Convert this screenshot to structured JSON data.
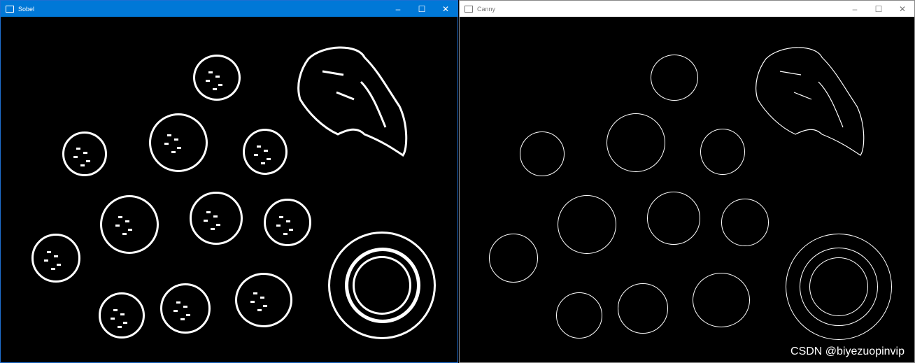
{
  "windows": {
    "sobel": {
      "title": "Sobel"
    },
    "canny": {
      "title": "Canny"
    }
  },
  "controls": {
    "minimize": "–",
    "maximize": "☐",
    "close": "✕"
  },
  "watermark": "CSDN @biyezuopinvip",
  "colors": {
    "active_titlebar": "#0078d7",
    "inactive_titlebar": "#ffffff",
    "edge": "#ffffff",
    "background": "#000000"
  }
}
